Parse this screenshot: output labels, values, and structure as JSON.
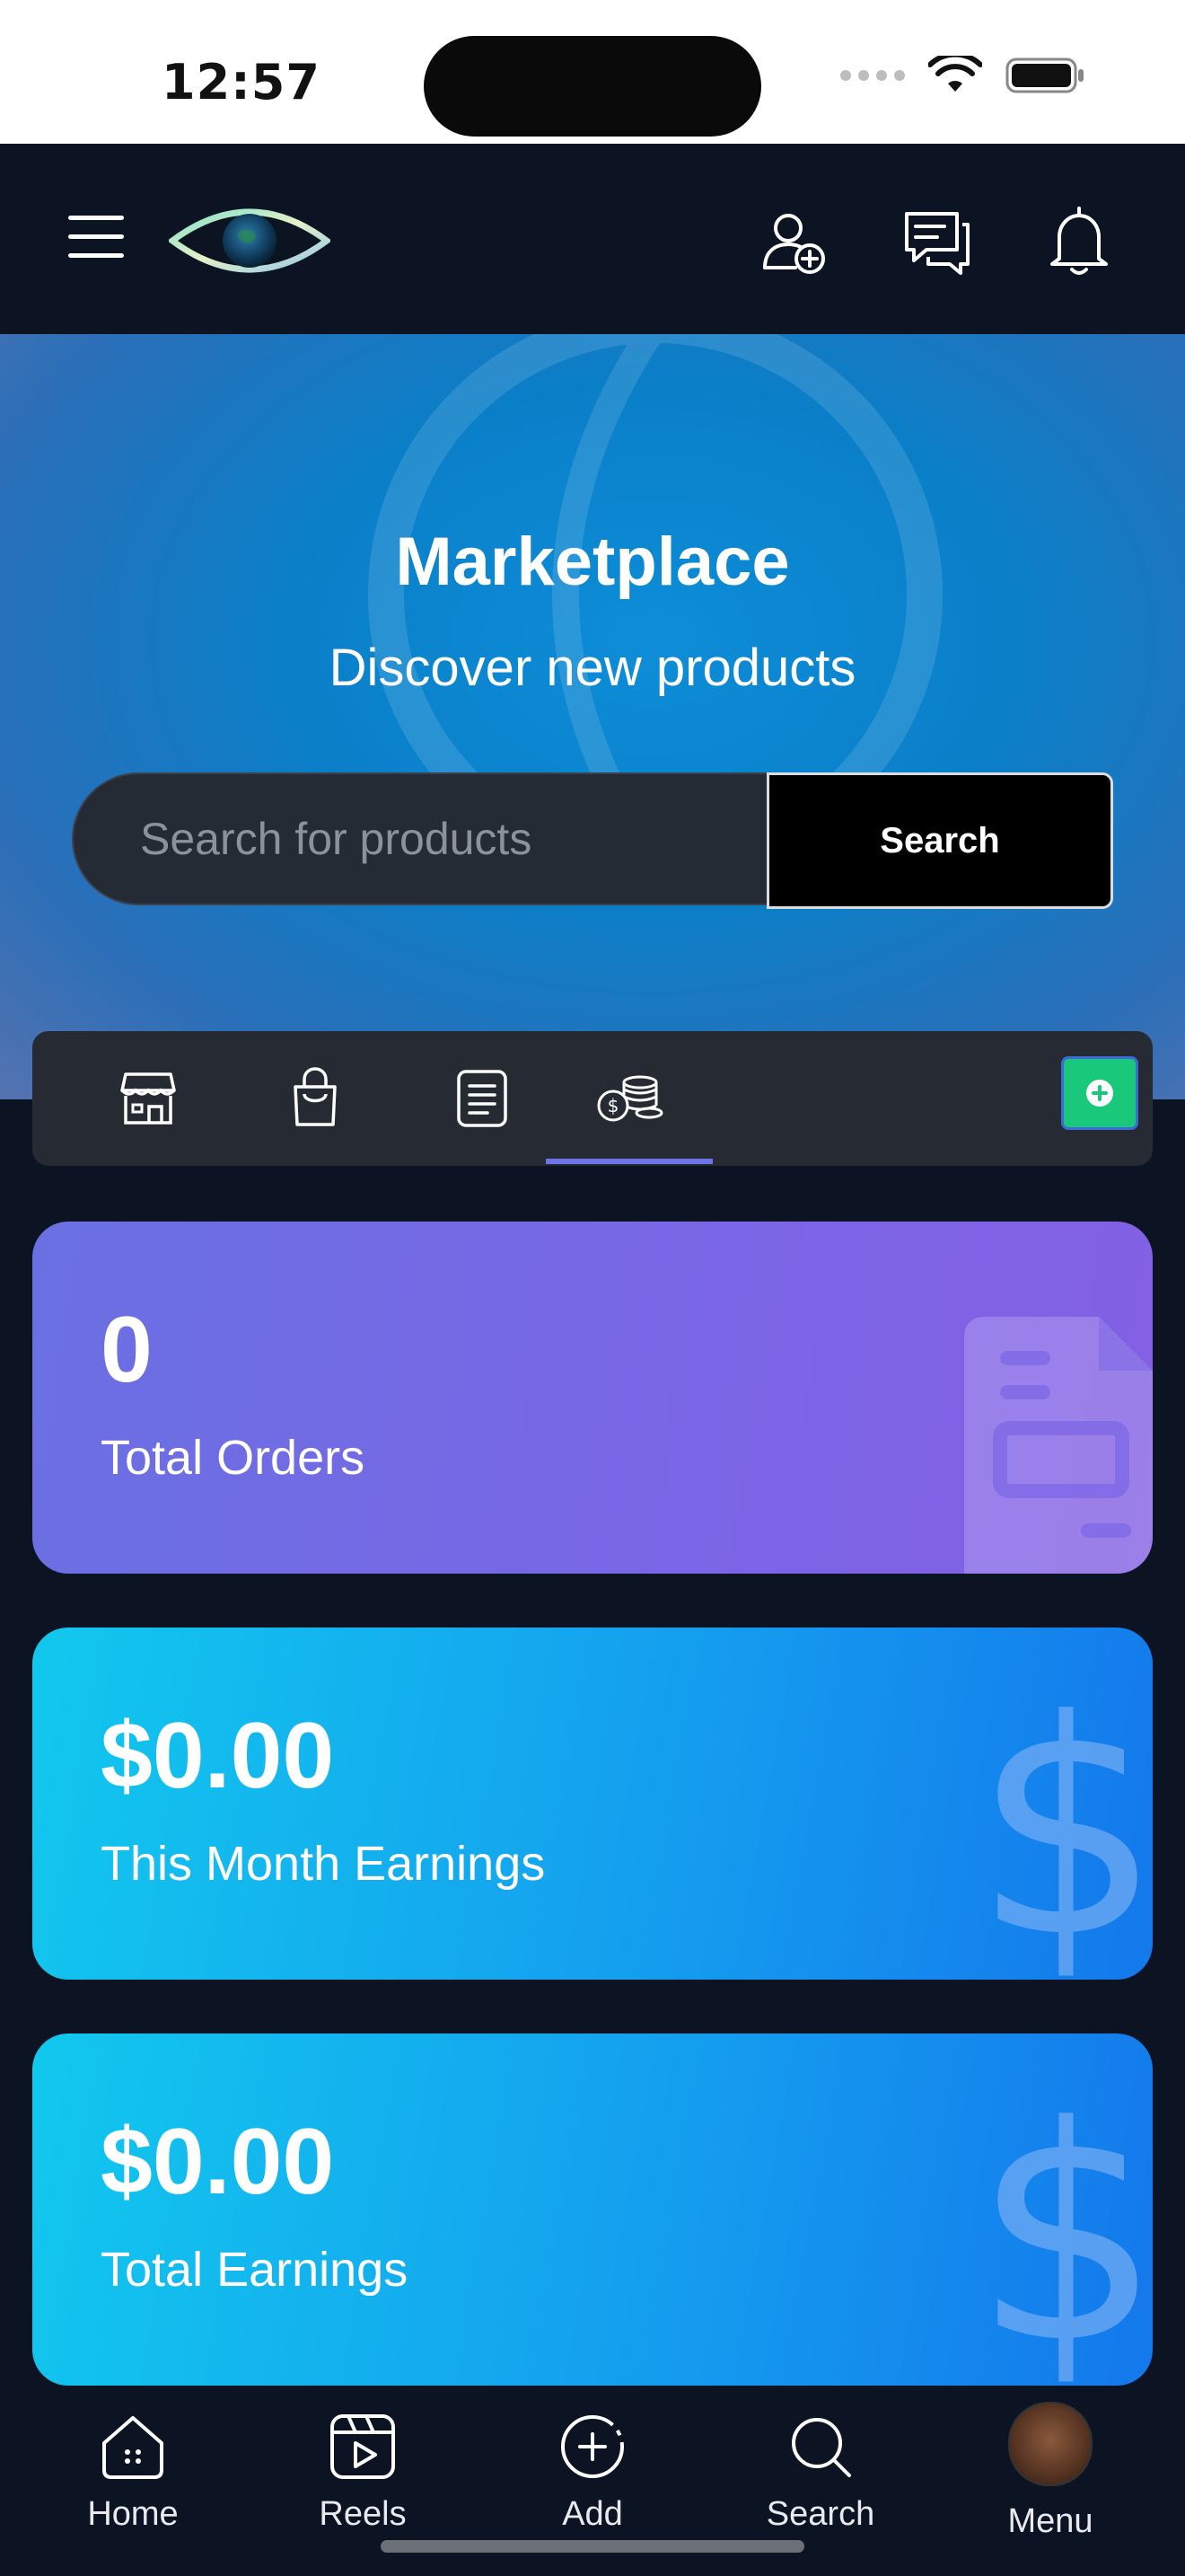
{
  "status_bar": {
    "time": "12:57"
  },
  "header": {
    "icons": [
      "menu-icon",
      "eye-logo",
      "add-user-icon",
      "chat-icon",
      "bell-icon"
    ]
  },
  "hero": {
    "title": "Marketplace",
    "subtitle": "Discover new products",
    "search": {
      "placeholder": "Search for products",
      "value": "",
      "button_label": "Search"
    }
  },
  "tabs": {
    "items": [
      {
        "icon": "store-icon",
        "active": false
      },
      {
        "icon": "shopping-bag-icon",
        "active": false
      },
      {
        "icon": "document-icon",
        "active": false
      },
      {
        "icon": "coins-icon",
        "active": true
      }
    ],
    "add_icon": "plus-icon"
  },
  "stats": [
    {
      "value": "0",
      "label": "Total Orders",
      "icon": "invoice-icon"
    },
    {
      "value": "$0.00",
      "label": "This Month Earnings",
      "icon": "dollar-icon"
    },
    {
      "value": "$0.00",
      "label": "Total Earnings",
      "icon": "dollar-icon"
    }
  ],
  "bottom_nav": [
    {
      "label": "Home",
      "icon": "home-icon"
    },
    {
      "label": "Reels",
      "icon": "reels-icon"
    },
    {
      "label": "Add",
      "icon": "add-circle-icon"
    },
    {
      "label": "Search",
      "icon": "search-icon"
    },
    {
      "label": "Menu",
      "icon": "avatar"
    }
  ],
  "colors": {
    "background": "#0c1424",
    "accent_tab": "#6d74e8",
    "add_button": "#19c87a",
    "orders_card": "#7a66e6",
    "earnings_card": "#149fee"
  }
}
